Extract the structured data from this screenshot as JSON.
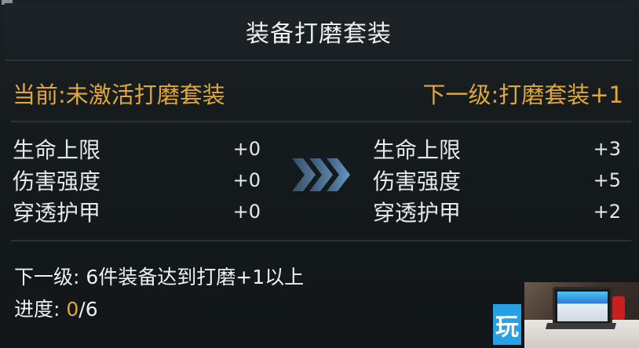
{
  "title": "装备打磨套装",
  "current_label": "当前:",
  "current_value": "未激活打磨套装",
  "next_label": "下一级:",
  "next_value": "打磨套装+1",
  "current_stats": [
    {
      "name": "生命上限",
      "value": "+0"
    },
    {
      "name": "伤害强度",
      "value": "+0"
    },
    {
      "name": "穿透护甲",
      "value": "+0"
    }
  ],
  "next_stats": [
    {
      "name": "生命上限",
      "value": "+3"
    },
    {
      "name": "伤害强度",
      "value": "+5"
    },
    {
      "name": "穿透护甲",
      "value": "+2"
    }
  ],
  "requirement": "下一级: 6件装备达到打磨+1以上",
  "progress_label": "进度:",
  "progress_current": "0",
  "progress_total": "/6",
  "watermark_logo": "玩",
  "colors": {
    "accent": "#e0a83a",
    "arrow": "#5a86b0",
    "logo": "#27a0e6"
  },
  "icons": {
    "arrow": "triple-chevron-right-icon"
  }
}
